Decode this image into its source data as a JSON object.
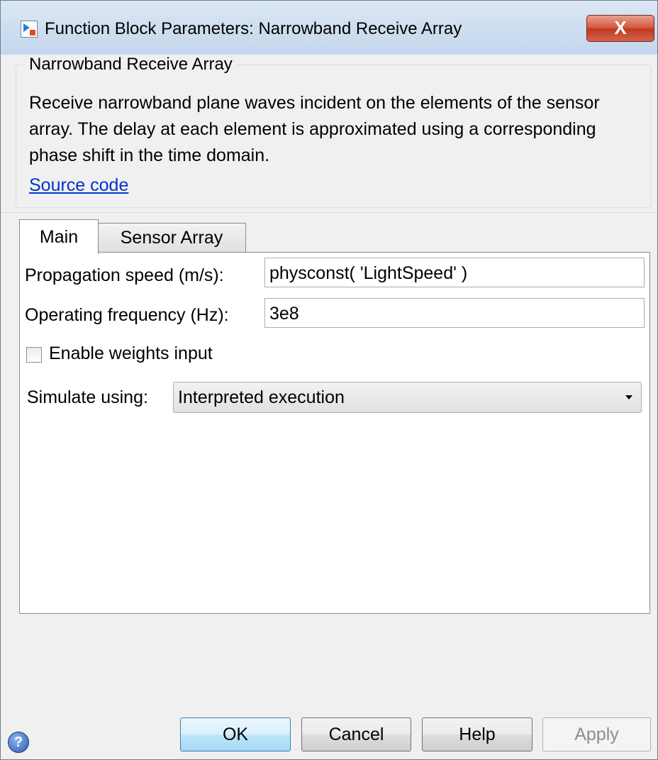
{
  "window": {
    "title": "Function Block Parameters: Narrowband Receive Array",
    "close_label": "X"
  },
  "description": {
    "group_title": "Narrowband Receive Array",
    "text": "Receive narrowband plane waves incident on the elements of the sensor array. The delay at each element is approximated using a corresponding phase shift in the time domain.",
    "link": "Source code"
  },
  "tabs": [
    {
      "label": "Main",
      "active": true
    },
    {
      "label": "Sensor Array",
      "active": false
    }
  ],
  "main": {
    "propagation_speed": {
      "label": "Propagation speed (m/s):",
      "value": "physconst( 'LightSpeed' )"
    },
    "operating_frequency": {
      "label": "Operating frequency (Hz):",
      "value": "3e8"
    },
    "enable_weights": {
      "label": "Enable weights input",
      "checked": false
    },
    "simulate_using": {
      "label": "Simulate using:",
      "value": "Interpreted execution"
    }
  },
  "buttons": {
    "ok": "OK",
    "cancel": "Cancel",
    "help": "Help",
    "apply": "Apply",
    "help_icon": "?"
  },
  "colors": {
    "link": "#0033cc",
    "close_button": "#c03a21",
    "ok_border": "#3c7fb1"
  }
}
